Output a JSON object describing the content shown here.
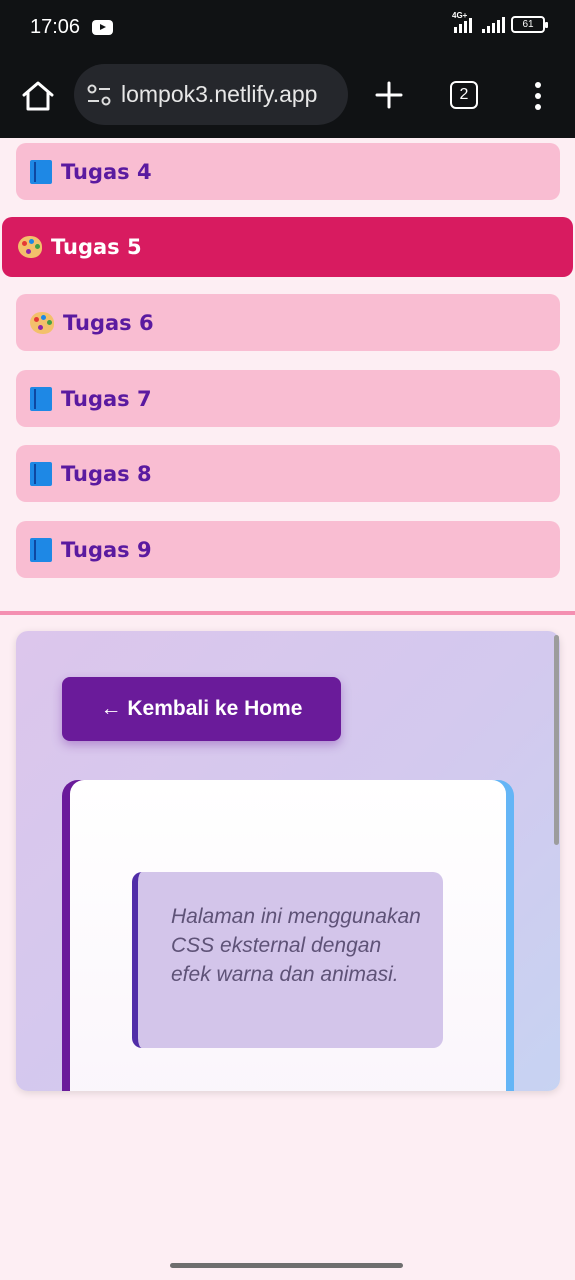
{
  "status_bar": {
    "time": "17:06",
    "network": "4G+",
    "battery": "61"
  },
  "browser": {
    "url": "lompok3.netlify.app",
    "tab_count": "2"
  },
  "menu": {
    "items": [
      {
        "label": "Tugas 4",
        "icon": "book-icon"
      },
      {
        "label": "Tugas 5",
        "icon": "palette-icon",
        "active": true
      },
      {
        "label": "Tugas 6",
        "icon": "palette-icon"
      },
      {
        "label": "Tugas 7",
        "icon": "book-icon"
      },
      {
        "label": "Tugas 8",
        "icon": "book-icon"
      },
      {
        "label": "Tugas 9",
        "icon": "book-icon"
      }
    ]
  },
  "content": {
    "back_button": "← Kembali ke Home",
    "quote": "Halaman ini menggunakan CSS eksternal dengan efek warna dan animasi."
  },
  "colors": {
    "menu_item": "#f9bdd2",
    "menu_item_active": "#d81b60",
    "menu_text": "#5a1aa0",
    "button": "#6a1b9a",
    "accent_blue": "#64b5f6"
  }
}
